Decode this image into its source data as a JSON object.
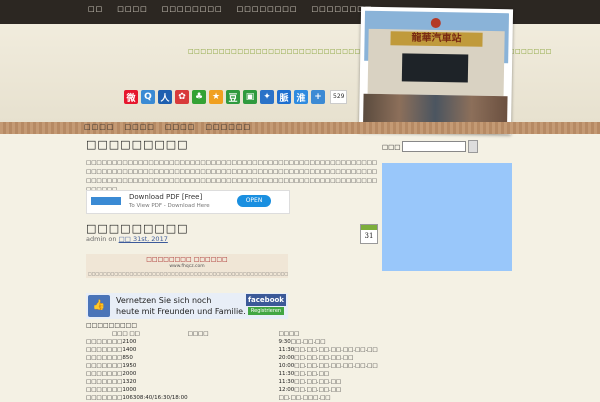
{
  "topnav": [
    "□□",
    "□□□□",
    "□□□□□□□□",
    "□□□□□□□□",
    "□□□□□□□□"
  ],
  "banner": {
    "tagline": "□□□□□□□□□□□□□□□□□□□□□□□□□□□□□□□□□□□□□□□□□□□□□□□□□□□□□□□□□□□",
    "photo_sign": "龍華汽車站",
    "share_count": "529"
  },
  "share_icons": [
    {
      "name": "weibo-icon",
      "glyph": "微",
      "color": "#e6162d"
    },
    {
      "name": "qzone-icon",
      "glyph": "Q",
      "color": "#3a8ad4"
    },
    {
      "name": "renren-icon",
      "glyph": "人",
      "color": "#1e5fb0"
    },
    {
      "name": "kaixin-icon",
      "glyph": "✿",
      "color": "#d83a3a"
    },
    {
      "name": "clover-icon",
      "glyph": "♣",
      "color": "#34a234"
    },
    {
      "name": "star-icon",
      "glyph": "★",
      "color": "#f0a020"
    },
    {
      "name": "douban-icon",
      "glyph": "豆",
      "color": "#2f9a3e"
    },
    {
      "name": "image-icon",
      "glyph": "▣",
      "color": "#2f9a3e"
    },
    {
      "name": "paw-icon",
      "glyph": "✦",
      "color": "#2a72c8"
    },
    {
      "name": "bookmark-icon",
      "glyph": "脈",
      "color": "#1e6fd0"
    },
    {
      "name": "huaban-icon",
      "glyph": "淮",
      "color": "#2f8be0"
    },
    {
      "name": "plus-icon",
      "glyph": "+",
      "color": "#3c8ad4"
    }
  ],
  "subnav": [
    "□□□□",
    "□□□□",
    "□□□□",
    "□□□□□□"
  ],
  "page": {
    "title": "□□□□□□□□□",
    "intro": "□□□□□□□□□□□□□□□□□□□□□□□□□□□□□□□□□□□□□□□□□□□□□□□□□□□□□□□□□□□□□□□□□□□□□□□□□□□□□□□□□□□□□□□□□□□□□□□□□□□□□□□□□□□□□□□□□□□□□□□□□□□□□□□□□□□□□□□□□□□□□□□□□□□□□□□□□□□□□□□□□□□□□□□□□□□□□□"
  },
  "ad_pdf": {
    "line1": "Download PDF [Free]",
    "line2": "To View PDF - Download Here",
    "button": "OPEN"
  },
  "post": {
    "title": "□□□□□□□□□",
    "author_prefix": "admin on ",
    "date": "□□ 31st, 2017",
    "calendar_day": "31"
  },
  "ad_box": {
    "heading": "□□□□□□□□ □□□□□□",
    "url": "www.fhqcz.com",
    "body": "□□□□□□□□□□□□□□□□□□□□□□□□□□□□□□□□□□□□□□□□□□□□□□□□□□□□□□□□□□□□"
  },
  "ad_facebook": {
    "line1": "Vernetzen Sie sich noch",
    "line2": "heute mit Freunden und Familie.",
    "brand": "facebook",
    "button": "Registrieren"
  },
  "schedule": {
    "title": "□□□□□□□□□",
    "header": [
      "",
      "□□□ □□",
      "□□□□",
      "",
      "□□□□"
    ],
    "rows": [
      [
        "□□□□□",
        "□□",
        "2100",
        "9:30□□.□□.□□"
      ],
      [
        "□□□□□",
        "□□",
        "1400",
        "11:30□□.□□.□□.□□.□□.□□.□□"
      ],
      [
        "□□□□□",
        "□□",
        "850",
        "20:00□□.□□.□□.□□.□□"
      ],
      [
        "□□□□□",
        "□□",
        "1950",
        "10:00□□.□□.□□.□□.□□.□□.□□"
      ],
      [
        "□□□□□",
        "□□",
        "2000",
        "11:30□□.□□.□□"
      ],
      [
        "□□□□□",
        "□□",
        "1320",
        "11:30□□.□□.□□.□□"
      ],
      [
        "□□□□□",
        "□□",
        "1000",
        "12:00□□.□□.□□.□□"
      ],
      [
        "□□□□□",
        "□□",
        "106308:40/16:30/18:00",
        "□□.□□.□□□.□□"
      ]
    ]
  },
  "search": {
    "label": "□□□",
    "placeholder": ""
  }
}
